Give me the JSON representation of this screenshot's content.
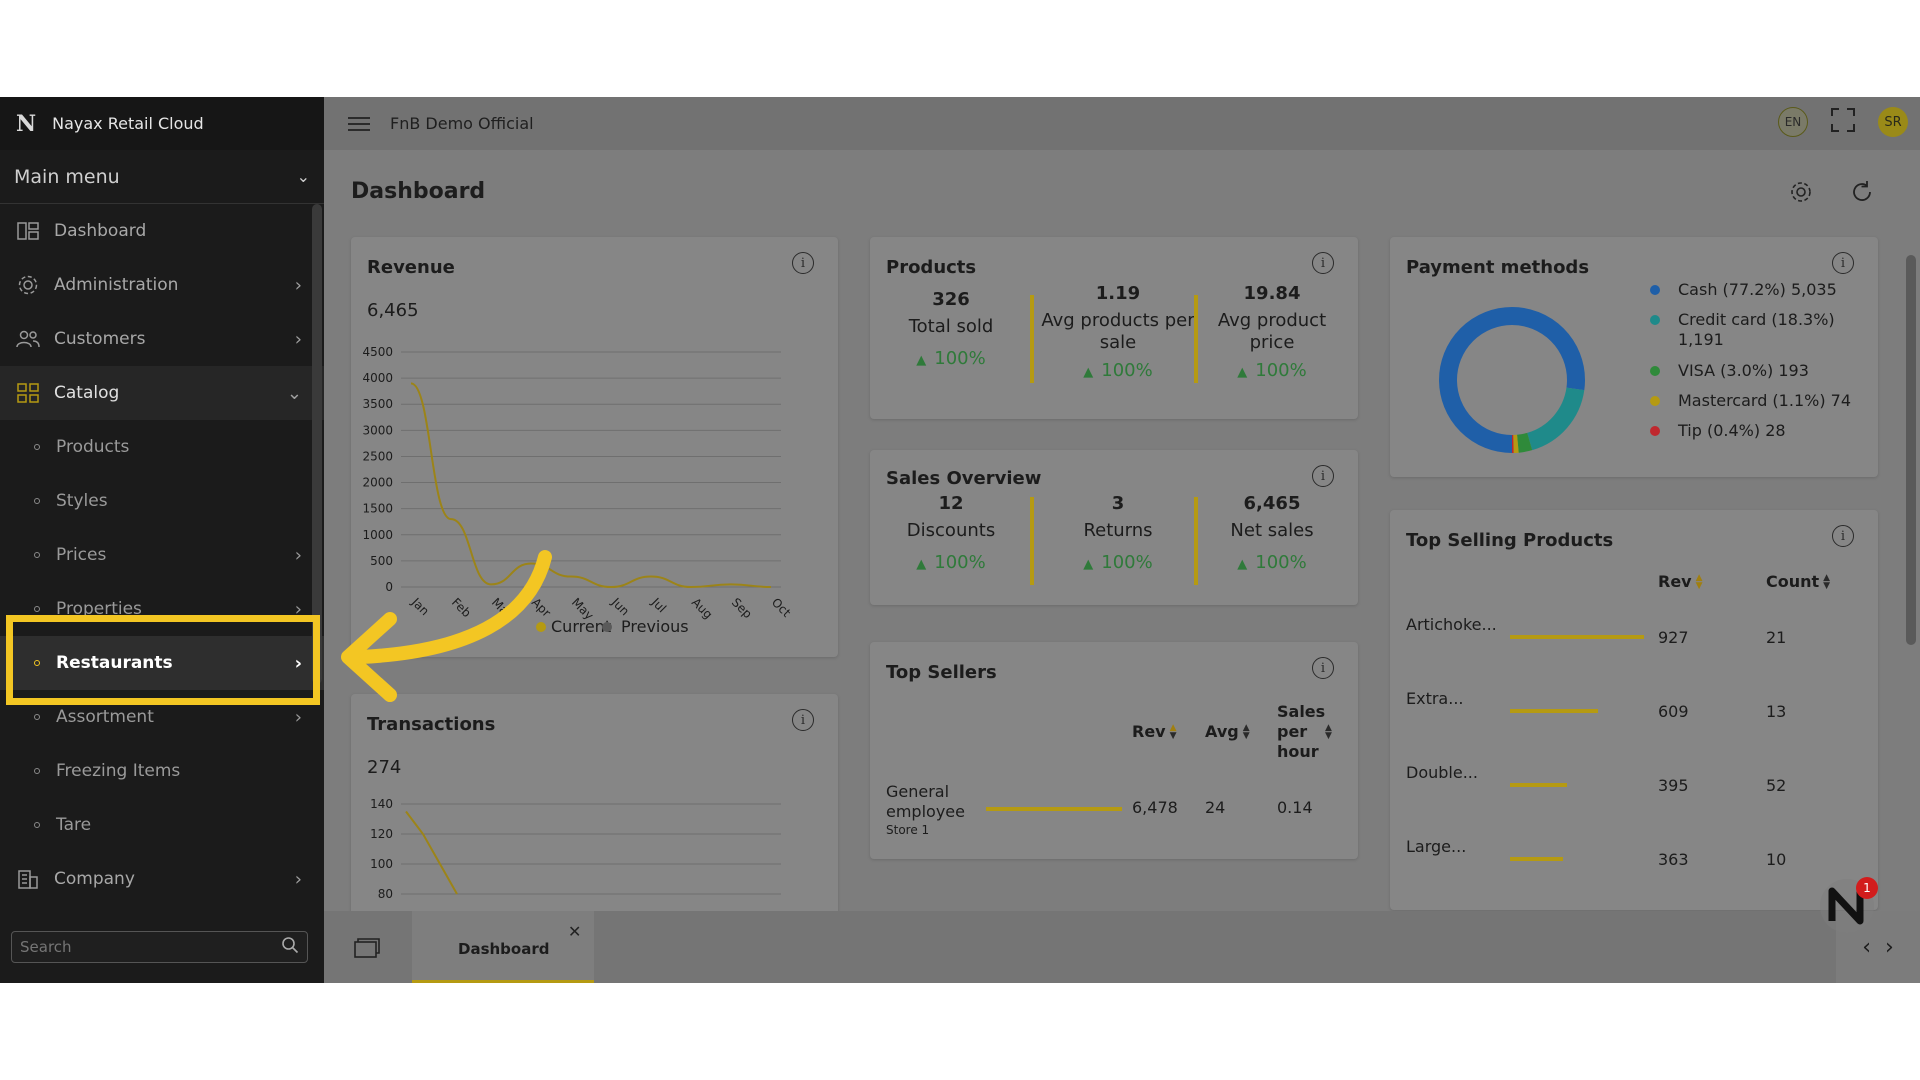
{
  "brand": {
    "logo": "N",
    "name": "Nayax Retail Cloud"
  },
  "sidebar": {
    "main_menu_label": "Main menu",
    "items": [
      {
        "label": "Dashboard",
        "icon": "dashboard-icon"
      },
      {
        "label": "Administration",
        "icon": "gear-icon"
      },
      {
        "label": "Customers",
        "icon": "users-icon"
      },
      {
        "label": "Catalog",
        "icon": "grid-icon"
      }
    ],
    "catalog_children": [
      "Products",
      "Styles",
      "Prices",
      "Properties",
      "Restaurants",
      "Assortment",
      "Freezing Items",
      "Tare"
    ],
    "company_label": "Company",
    "search_placeholder": "Search"
  },
  "topbar": {
    "title": "FnB Demo Official",
    "lang": "EN",
    "avatar": "SR"
  },
  "page": {
    "title": "Dashboard"
  },
  "revenue": {
    "title": "Revenue",
    "total": "6,465",
    "legend_current": "Current",
    "legend_previous": "Previous",
    "info": "i"
  },
  "products": {
    "title": "Products",
    "kpis": [
      {
        "value": "326",
        "label": "Total sold",
        "pct": "100%"
      },
      {
        "value": "1.19",
        "label": "Avg products per sale",
        "pct": "100%"
      },
      {
        "value": "19.84",
        "label": "Avg product price",
        "pct": "100%"
      }
    ]
  },
  "sales_overview": {
    "title": "Sales Overview",
    "kpis": [
      {
        "value": "12",
        "label": "Discounts",
        "pct": "100%"
      },
      {
        "value": "3",
        "label": "Returns",
        "pct": "100%"
      },
      {
        "value": "6,465",
        "label": "Net sales",
        "pct": "100%"
      }
    ]
  },
  "payment_methods": {
    "title": "Payment methods",
    "items": [
      {
        "label": "Cash (77.2%) 5,035",
        "color": "#1f5fa8"
      },
      {
        "label": "Credit card (18.3%) 1,191",
        "color": "#1f8a8a"
      },
      {
        "label": "VISA (3.0%) 193",
        "color": "#2f8a3a"
      },
      {
        "label": "Mastercard (1.1%) 74",
        "color": "#b59a12"
      },
      {
        "label": "Tip (0.4%) 28",
        "color": "#c0282e"
      }
    ]
  },
  "top_sellers": {
    "title": "Top Sellers",
    "headers": {
      "rev": "Rev",
      "avg": "Avg",
      "sales_per_hour": "Sales per hour"
    },
    "rows": [
      {
        "name": "General employee",
        "store": "Store 1",
        "rev": "6,478",
        "avg": "24",
        "sph": "0.14",
        "bar": 1.0
      }
    ]
  },
  "top_selling_products": {
    "title": "Top Selling Products",
    "headers": {
      "rev": "Rev",
      "count": "Count"
    },
    "rows": [
      {
        "name": "Artichoke...",
        "rev": "927",
        "count": "21",
        "bar": 1.0
      },
      {
        "name": "Extra...",
        "rev": "609",
        "count": "13",
        "bar": 0.657
      },
      {
        "name": "Double...",
        "rev": "395",
        "count": "52",
        "bar": 0.426
      },
      {
        "name": "Large...",
        "rev": "363",
        "count": "10",
        "bar": 0.392
      }
    ]
  },
  "transactions": {
    "title": "Transactions",
    "total": "274"
  },
  "bottom_tab": {
    "label": "Dashboard",
    "close": "✕"
  },
  "notifications": {
    "count": "1"
  },
  "chart_data": [
    {
      "type": "line",
      "x": [
        "Jan",
        "Feb",
        "Mar",
        "Apr",
        "May",
        "Jun",
        "Jul",
        "Aug",
        "Sep",
        "Oct"
      ],
      "series": [
        {
          "name": "Current",
          "values": [
            3900,
            1300,
            50,
            450,
            200,
            0,
            200,
            0,
            50,
            0
          ]
        },
        {
          "name": "Previous",
          "values": [
            0,
            0,
            0,
            0,
            0,
            0,
            0,
            0,
            0,
            0
          ]
        }
      ],
      "yticks": [
        0,
        500,
        1000,
        1500,
        2000,
        2500,
        3000,
        3500,
        4000,
        4500
      ],
      "ylim": [
        0,
        4500
      ]
    },
    {
      "type": "pie",
      "categories": [
        "Cash",
        "Credit card",
        "VISA",
        "Mastercard",
        "Tip"
      ],
      "values": [
        77.2,
        18.3,
        3.0,
        1.1,
        0.4
      ]
    },
    {
      "type": "line",
      "series": [
        {
          "name": "",
          "values": [
            135,
            120,
            100,
            80
          ]
        }
      ],
      "yticks": [
        80,
        100,
        120,
        140
      ]
    }
  ]
}
